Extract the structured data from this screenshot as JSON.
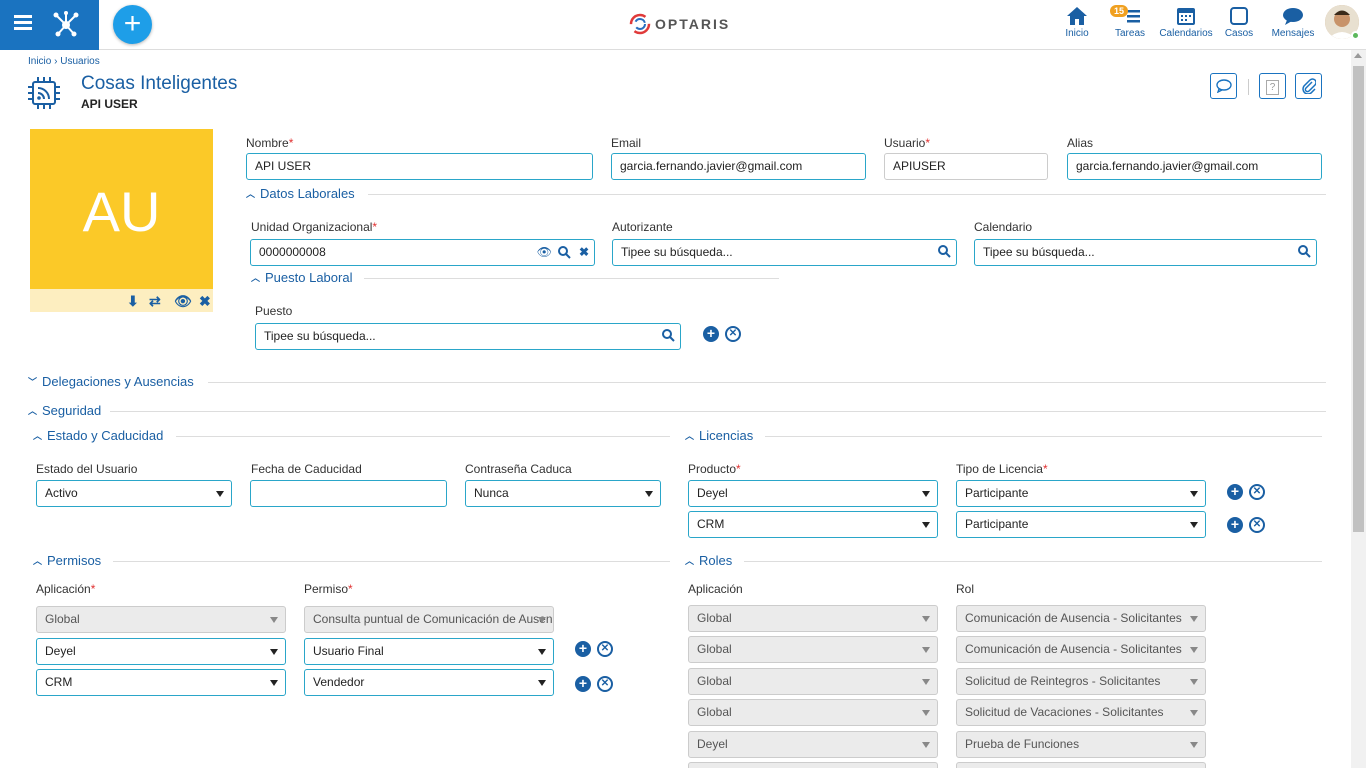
{
  "topbar": {
    "logo": "OPTARIS",
    "nav": [
      {
        "label": "Inicio",
        "icon": "home-icon"
      },
      {
        "label": "Tareas",
        "icon": "tasks-icon",
        "badge": "15"
      },
      {
        "label": "Calendarios",
        "icon": "calendar-icon"
      },
      {
        "label": "Casos",
        "icon": "cases-icon"
      },
      {
        "label": "Mensajes",
        "icon": "chat-icon"
      }
    ]
  },
  "breadcrumb": {
    "home": "Inicio",
    "sep": "›",
    "current": "Usuarios"
  },
  "header": {
    "title": "Cosas Inteligentes",
    "subtitle": "API USER"
  },
  "photo": {
    "initials": "AU"
  },
  "user": {
    "nombre_label": "Nombre",
    "nombre": "API USER",
    "email_label": "Email",
    "email": "garcia.fernando.javier@gmail.com",
    "usuario_label": "Usuario",
    "usuario": "APIUSER",
    "alias_label": "Alias",
    "alias": "garcia.fernando.javier@gmail.com"
  },
  "laborales": {
    "section": "Datos Laborales",
    "unidad_label": "Unidad Organizacional",
    "unidad": "0000000008",
    "autorizante_label": "Autorizante",
    "autorizante_placeholder": "Tipee su búsqueda...",
    "calendario_label": "Calendario",
    "calendario_placeholder": "Tipee su búsqueda...",
    "puesto_section": "Puesto Laboral",
    "puesto_label": "Puesto",
    "puesto_placeholder": "Tipee su búsqueda..."
  },
  "delegaciones": {
    "section": "Delegaciones y Ausencias"
  },
  "seguridad": {
    "section": "Seguridad"
  },
  "estado": {
    "section": "Estado y Caducidad",
    "estado_label": "Estado del Usuario",
    "estado": "Activo",
    "fecha_label": "Fecha de Caducidad",
    "fecha": "",
    "contrasena_label": "Contraseña Caduca",
    "contrasena": "Nunca"
  },
  "licencias": {
    "section": "Licencias",
    "producto_label": "Producto",
    "tipo_label": "Tipo de Licencia",
    "rows": [
      {
        "producto": "Deyel",
        "tipo": "Participante"
      },
      {
        "producto": "CRM",
        "tipo": "Participante"
      }
    ]
  },
  "permisos": {
    "section": "Permisos",
    "app_label": "Aplicación",
    "permiso_label": "Permiso",
    "rows": [
      {
        "app": "Global",
        "permiso": "Consulta puntual de Comunicación de Ausencias"
      },
      {
        "app": "Deyel",
        "permiso": "Usuario Final"
      },
      {
        "app": "CRM",
        "permiso": "Vendedor"
      }
    ]
  },
  "roles": {
    "section": "Roles",
    "app_label": "Aplicación",
    "rol_label": "Rol",
    "rows": [
      {
        "app": "Global",
        "rol": "Comunicación de Ausencia - Solicitantes"
      },
      {
        "app": "Global",
        "rol": "Comunicación de Ausencia - Solicitantes"
      },
      {
        "app": "Global",
        "rol": "Solicitud de Reintegros - Solicitantes"
      },
      {
        "app": "Global",
        "rol": "Solicitud de Vacaciones - Solicitantes"
      },
      {
        "app": "Deyel",
        "rol": "Prueba de Funciones"
      }
    ]
  }
}
